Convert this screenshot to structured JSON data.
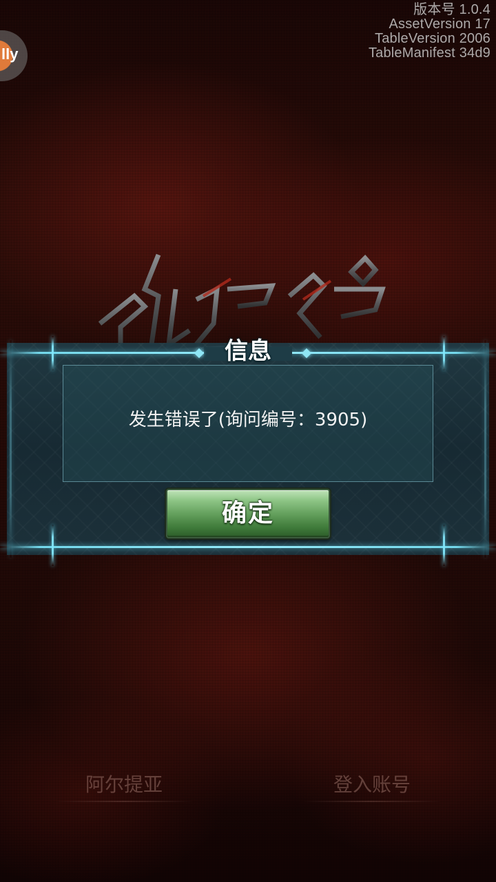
{
  "version_info": {
    "version": "版本号 1.0.4",
    "asset_version": "AssetVersion 17",
    "table_version": "TableVersion 2006",
    "table_manifest": "TableManifest 34d9"
  },
  "float_ball": {
    "label": "lly",
    "icon": "assistive-ball-icon",
    "color": "#e07a3a"
  },
  "logo": {
    "icon": "game-logo"
  },
  "dialog": {
    "title": "信息",
    "message": "发生错误了(询问编号：3905)",
    "confirm_label": "确定",
    "accent_color": "#8fe6f5",
    "button_color": "#5e9a57"
  },
  "bottom_menu": {
    "left_label": "阿尔提亚",
    "right_label": "登入账号"
  }
}
